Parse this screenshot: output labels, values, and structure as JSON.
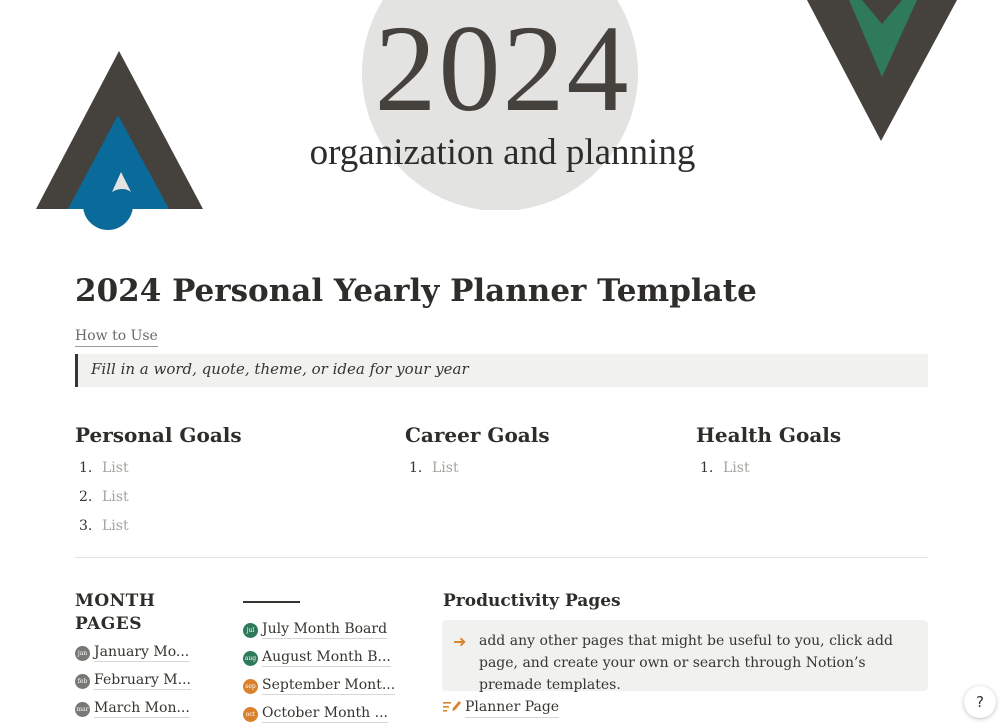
{
  "colors": {
    "text": "#37352f",
    "muted": "#a5a39f",
    "cover_dark": "#45423e",
    "cover_blue": "#0a6b9a",
    "cover_green": "#2e7a5a",
    "cover_circle": "#e3e3e1",
    "callout_bg": "#f1f1ef",
    "accent_orange": "#d9822b"
  },
  "cover": {
    "year": "2024",
    "subtitle": "organization and planning"
  },
  "page": {
    "title": "2024 Personal Yearly Planner Template",
    "how_to_use": "How to Use",
    "quote": "Fill in a word, quote, theme, or idea for your year"
  },
  "goals": {
    "personal": {
      "title": "Personal Goals",
      "items": [
        {
          "num": "1.",
          "text": "List"
        },
        {
          "num": "2.",
          "text": "List"
        },
        {
          "num": "3.",
          "text": "List"
        }
      ]
    },
    "career": {
      "title": "Career Goals",
      "items": [
        {
          "num": "1.",
          "text": "List"
        }
      ]
    },
    "health": {
      "title": "Health Goals",
      "items": [
        {
          "num": "1.",
          "text": "List"
        }
      ]
    }
  },
  "months": {
    "heading": "MONTH PAGES",
    "left": [
      {
        "icon": "jan",
        "icon_color": "#7a7874",
        "label": "January Mo..."
      },
      {
        "icon": "feb",
        "icon_color": "#7a7874",
        "label": "February M..."
      },
      {
        "icon": "mar",
        "icon_color": "#7a7874",
        "label": "March Mon..."
      }
    ],
    "right": [
      {
        "icon": "jul",
        "icon_color": "#2e7a5a",
        "label": "July Month Board"
      },
      {
        "icon": "aug",
        "icon_color": "#2e7a5a",
        "label": "August Month B..."
      },
      {
        "icon": "sep",
        "icon_color": "#d9822b",
        "label": "September Mont..."
      },
      {
        "icon": "oct",
        "icon_color": "#d9822b",
        "label": "October Month ..."
      }
    ]
  },
  "productivity": {
    "heading": "Productivity Pages",
    "callout_icon": "arrow-right-icon",
    "callout_text": "add any other pages that might be useful to you, click add page, and create your own or search through Notion’s premade templates.",
    "planner_icon": "edit-list-icon",
    "planner_label": "Planner Page"
  },
  "help": {
    "label": "?"
  }
}
